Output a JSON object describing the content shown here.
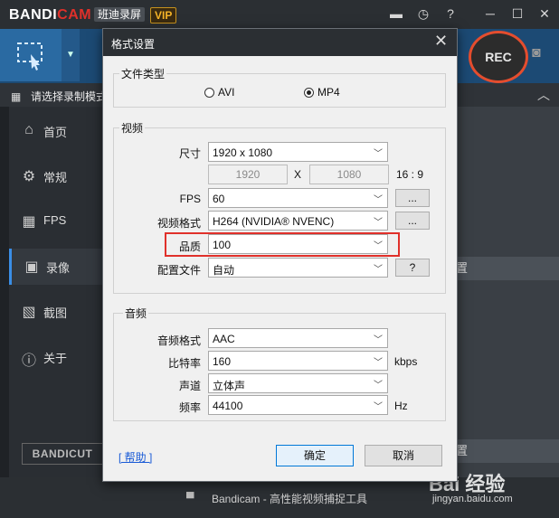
{
  "app": {
    "logo_part1": "BANDI",
    "logo_part2": "CAM",
    "brand_cn": "班迪录屏",
    "vip": "VIP",
    "rec": "REC",
    "mode_label": "请选择录制模式",
    "caret": "︿"
  },
  "sidebar": {
    "items": [
      {
        "label": "首页",
        "icon": "home-icon",
        "glyph": "⌂"
      },
      {
        "label": "常规",
        "icon": "gear-icon",
        "glyph": "⚙"
      },
      {
        "label": "FPS",
        "icon": "fps-icon",
        "glyph": "▦"
      },
      {
        "label": "录像",
        "icon": "video-settings-icon",
        "glyph": "▣"
      },
      {
        "label": "截图",
        "icon": "image-icon",
        "glyph": "▧"
      },
      {
        "label": "关于",
        "icon": "info-icon",
        "glyph": "ⓘ"
      }
    ],
    "bandicut": "BANDICUT"
  },
  "right_panel": {
    "btn1": "置",
    "btn2": "置"
  },
  "footer": {
    "text": "Bandicam - 高性能视频捕捉工具"
  },
  "watermark": {
    "main": "Bai 经验",
    "sub": "jingyan.baidu.com"
  },
  "dialog": {
    "title": "格式设置",
    "file_type": {
      "title": "文件类型",
      "options": [
        "AVI",
        "MP4"
      ],
      "selected": "MP4"
    },
    "video": {
      "title": "视频",
      "size_label": "尺寸",
      "size_value": "1920 x 1080",
      "width": "1920",
      "x": "X",
      "height": "1080",
      "ratio": "16 : 9",
      "fps_label": "FPS",
      "fps_value": "60",
      "codec_label": "视频格式",
      "codec_value": "H264 (NVIDIA® NVENC)",
      "quality_label": "品质",
      "quality_value": "100",
      "profile_label": "配置文件",
      "profile_value": "自动",
      "more": "...",
      "help_q": "?"
    },
    "audio": {
      "title": "音频",
      "format_label": "音频格式",
      "format_value": "AAC",
      "bitrate_label": "比特率",
      "bitrate_value": "160",
      "bitrate_unit": "kbps",
      "channel_label": "声道",
      "channel_value": "立体声",
      "freq_label": "频率",
      "freq_value": "44100",
      "freq_unit": "Hz"
    },
    "help_link": "[ 帮助 ]",
    "ok": "确定",
    "cancel": "取消"
  },
  "colors": {
    "accent_red": "#e0302a",
    "primary_blue": "#0078d7",
    "vip_gold": "#f5b428"
  }
}
